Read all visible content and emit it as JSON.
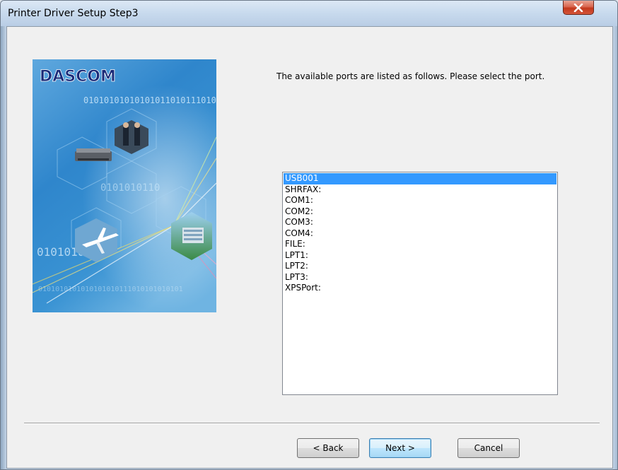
{
  "window": {
    "title": "Printer Driver Setup Step3"
  },
  "banner": {
    "logo_text": "DASCOM",
    "binary_1": "01010101010101011010111010",
    "binary_2": "0101010110",
    "binary_3": "0101010101",
    "binary_4": "0101010101010101010111010101010101"
  },
  "instruction": "The available ports are listed as follows. Please select the port.",
  "ports": {
    "selected": "USB001",
    "items": [
      "USB001",
      "SHRFAX:",
      "COM1:",
      "COM2:",
      "COM3:",
      "COM4:",
      "FILE:",
      "LPT1:",
      "LPT2:",
      "LPT3:",
      "XPSPort:"
    ]
  },
  "buttons": {
    "back": "< Back",
    "next": "Next >",
    "cancel": "Cancel"
  },
  "colors": {
    "selection": "#3399ff",
    "close_button": "#c3381c",
    "banner_blue": "#2f7fc6"
  }
}
